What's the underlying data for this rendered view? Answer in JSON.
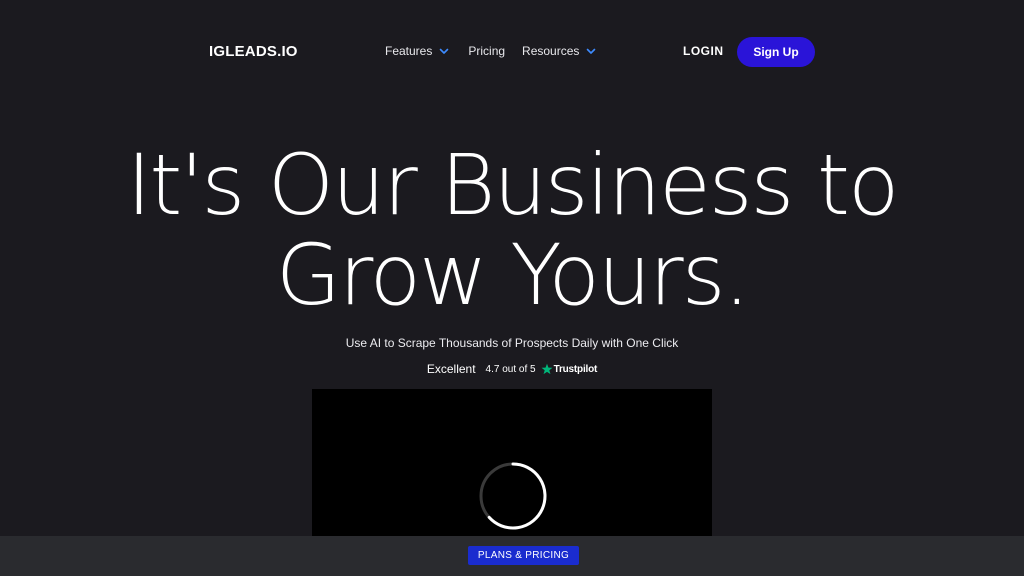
{
  "header": {
    "logo": "IGLEADS.IO",
    "nav": {
      "features": "Features",
      "pricing": "Pricing",
      "resources": "Resources"
    },
    "login": "LOGIN",
    "signup": "Sign Up"
  },
  "hero": {
    "title_line1": "It's Our Business to",
    "title_line2": "Grow Yours.",
    "subtitle": "Use AI to Scrape Thousands of Prospects Daily with One Click",
    "rating": {
      "word": "Excellent",
      "score": "4.7 out of 5",
      "brand": "Trustpilot"
    }
  },
  "video": {
    "state": "loading"
  },
  "bottom_bar": {
    "cta": "PLANS & PRICING"
  },
  "colors": {
    "background": "#1b1a1f",
    "accent_blue": "#2a14d8",
    "chevron_blue": "#3d8bff",
    "trustpilot_green": "#00b67a",
    "bottom_bar": "#2a2b2f"
  },
  "icons": {
    "features_dropdown": "chevron-down-icon",
    "resources_dropdown": "chevron-down-icon",
    "trustpilot": "star-icon",
    "video_loading": "spinner-icon"
  }
}
